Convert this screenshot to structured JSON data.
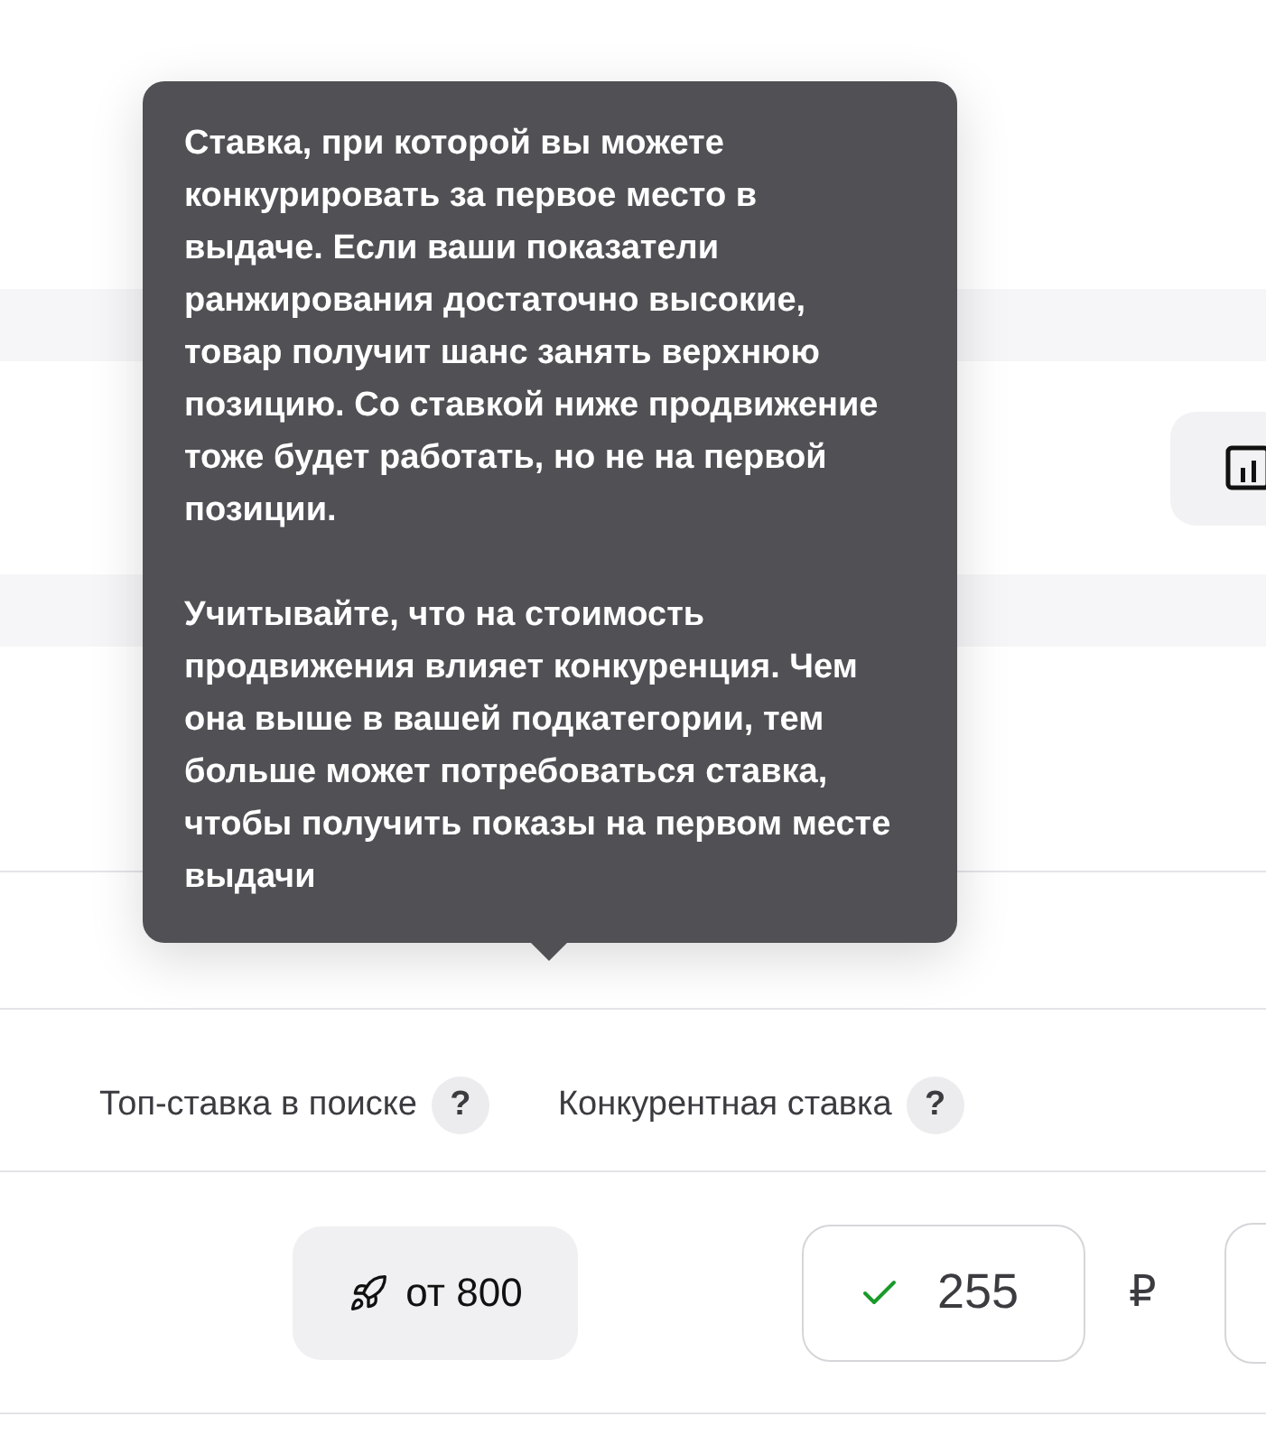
{
  "tooltip": {
    "paragraphs": [
      "Ставка, при которой вы можете конкурировать за первое место в выдаче. Если ваши показатели ранжирования достаточно высокие, товар получит шанс занять верхнюю позицию. Со ставкой ниже продвижение тоже будет работать, но не на первой позиции.",
      "Учитывайте, что на стоимость продвижения влияет конкуренция. Чем она выше в вашей подкатегории, тем больше может потребоваться ставка, чтобы получить показы на первом месте выдачи"
    ]
  },
  "columns": [
    {
      "label": "Топ-ставка в поиске",
      "help": "?"
    },
    {
      "label": "Конкурентная ставка",
      "help": "?"
    }
  ],
  "row": {
    "top_bid_button": {
      "label": "от 800"
    },
    "bid_field": {
      "value": "255",
      "valid": true
    },
    "currency": "₽"
  }
}
